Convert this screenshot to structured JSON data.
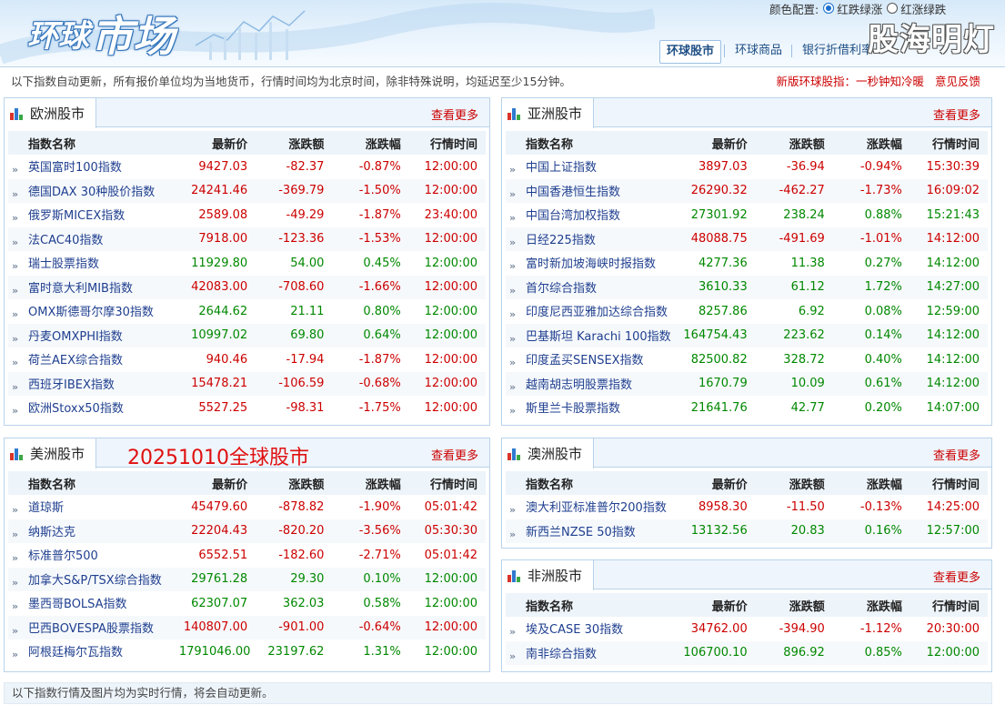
{
  "header": {
    "logo_part1": "环球",
    "logo_part2": "市场",
    "color_config_label": "颜色配置:",
    "color_options": [
      "红跌绿涨",
      "红涨绿跌"
    ],
    "watermark": "股海明灯",
    "nav": [
      "环球股市",
      "环球商品",
      "银行折借利率"
    ]
  },
  "notice": {
    "text": "以下指数自动更新，所有报价单位均为当地货币，行情时间均为北京时间，除非特殊说明，均延迟至少15分钟。",
    "links": [
      "新版环球股指：一秒钟知冷暖",
      "意见反馈"
    ]
  },
  "columns": [
    "指数名称",
    "最新价",
    "涨跌额",
    "涨跌幅",
    "行情时间"
  ],
  "more_label": "查看更多",
  "colors": {
    "up": "#cc0000",
    "down": "#008800",
    "link": "#1f3f8f",
    "accent": "#1a6fd0"
  },
  "panels": {
    "europe": {
      "title": "欧洲股市",
      "rows": [
        {
          "name": "英国富时100指数",
          "price": "9427.03",
          "chg": "-82.37",
          "pct": "-0.87%",
          "time": "12:00:00",
          "dir": "up"
        },
        {
          "name": "德国DAX 30种股价指数",
          "price": "24241.46",
          "chg": "-369.79",
          "pct": "-1.50%",
          "time": "12:00:00",
          "dir": "up"
        },
        {
          "name": "俄罗斯MICEX指数",
          "price": "2589.08",
          "chg": "-49.29",
          "pct": "-1.87%",
          "time": "23:40:00",
          "dir": "up"
        },
        {
          "name": "法CAC40指数",
          "price": "7918.00",
          "chg": "-123.36",
          "pct": "-1.53%",
          "time": "12:00:00",
          "dir": "up"
        },
        {
          "name": "瑞士股票指数",
          "price": "11929.80",
          "chg": "54.00",
          "pct": "0.45%",
          "time": "12:00:00",
          "dir": "dn"
        },
        {
          "name": "富时意大利MIB指数",
          "price": "42083.00",
          "chg": "-708.60",
          "pct": "-1.66%",
          "time": "12:00:00",
          "dir": "up"
        },
        {
          "name": "OMX斯德哥尔摩30指数",
          "price": "2644.62",
          "chg": "21.11",
          "pct": "0.80%",
          "time": "12:00:00",
          "dir": "dn"
        },
        {
          "name": "丹麦OMXPHI指数",
          "price": "10997.02",
          "chg": "69.80",
          "pct": "0.64%",
          "time": "12:00:00",
          "dir": "dn"
        },
        {
          "name": "荷兰AEX综合指数",
          "price": "940.46",
          "chg": "-17.94",
          "pct": "-1.87%",
          "time": "12:00:00",
          "dir": "up"
        },
        {
          "name": "西班牙IBEX指数",
          "price": "15478.21",
          "chg": "-106.59",
          "pct": "-0.68%",
          "time": "12:00:00",
          "dir": "up"
        },
        {
          "name": "欧洲Stoxx50指数",
          "price": "5527.25",
          "chg": "-98.31",
          "pct": "-1.75%",
          "time": "12:00:00",
          "dir": "up"
        }
      ]
    },
    "asia": {
      "title": "亚洲股市",
      "rows": [
        {
          "name": "中国上证指数",
          "price": "3897.03",
          "chg": "-36.94",
          "pct": "-0.94%",
          "time": "15:30:39",
          "dir": "up"
        },
        {
          "name": "中国香港恒生指数",
          "price": "26290.32",
          "chg": "-462.27",
          "pct": "-1.73%",
          "time": "16:09:02",
          "dir": "up"
        },
        {
          "name": "中国台湾加权指数",
          "price": "27301.92",
          "chg": "238.24",
          "pct": "0.88%",
          "time": "15:21:43",
          "dir": "dn"
        },
        {
          "name": "日经225指数",
          "price": "48088.75",
          "chg": "-491.69",
          "pct": "-1.01%",
          "time": "14:12:00",
          "dir": "up"
        },
        {
          "name": "富时新加坡海峡时报指数",
          "price": "4277.36",
          "chg": "11.38",
          "pct": "0.27%",
          "time": "14:12:00",
          "dir": "dn"
        },
        {
          "name": "首尔综合指数",
          "price": "3610.33",
          "chg": "61.12",
          "pct": "1.72%",
          "time": "14:27:00",
          "dir": "dn"
        },
        {
          "name": "印度尼西亚雅加达综合指数",
          "price": "8257.86",
          "chg": "6.92",
          "pct": "0.08%",
          "time": "12:59:00",
          "dir": "dn"
        },
        {
          "name": "巴基斯坦 Karachi 100指数",
          "price": "164754.43",
          "chg": "223.62",
          "pct": "0.14%",
          "time": "14:12:00",
          "dir": "dn"
        },
        {
          "name": "印度孟买SENSEX指数",
          "price": "82500.82",
          "chg": "328.72",
          "pct": "0.40%",
          "time": "14:12:00",
          "dir": "dn"
        },
        {
          "name": "越南胡志明股票指数",
          "price": "1670.79",
          "chg": "10.09",
          "pct": "0.61%",
          "time": "14:12:00",
          "dir": "dn"
        },
        {
          "name": "斯里兰卡股票指数",
          "price": "21641.76",
          "chg": "42.77",
          "pct": "0.20%",
          "time": "14:07:00",
          "dir": "dn"
        }
      ]
    },
    "america": {
      "title": "美洲股市",
      "extra": "20251010全球股市",
      "rows": [
        {
          "name": "道琼斯",
          "price": "45479.60",
          "chg": "-878.82",
          "pct": "-1.90%",
          "time": "05:01:42",
          "dir": "up"
        },
        {
          "name": "纳斯达克",
          "price": "22204.43",
          "chg": "-820.20",
          "pct": "-3.56%",
          "time": "05:30:30",
          "dir": "up"
        },
        {
          "name": "标准普尔500",
          "price": "6552.51",
          "chg": "-182.60",
          "pct": "-2.71%",
          "time": "05:01:42",
          "dir": "up"
        },
        {
          "name": "加拿大S&P/TSX综合指数",
          "price": "29761.28",
          "chg": "29.30",
          "pct": "0.10%",
          "time": "12:00:00",
          "dir": "dn"
        },
        {
          "name": "墨西哥BOLSA指数",
          "price": "62307.07",
          "chg": "362.03",
          "pct": "0.58%",
          "time": "12:00:00",
          "dir": "dn"
        },
        {
          "name": "巴西BOVESPA股票指数",
          "price": "140807.00",
          "chg": "-901.00",
          "pct": "-0.64%",
          "time": "12:00:00",
          "dir": "up"
        },
        {
          "name": "阿根廷梅尔瓦指数",
          "price": "1791046.00",
          "chg": "23197.62",
          "pct": "1.31%",
          "time": "12:00:00",
          "dir": "dn"
        }
      ]
    },
    "oceania": {
      "title": "澳洲股市",
      "rows": [
        {
          "name": "澳大利亚标准普尔200指数",
          "price": "8958.30",
          "chg": "-11.50",
          "pct": "-0.13%",
          "time": "14:25:00",
          "dir": "up"
        },
        {
          "name": "新西兰NZSE 50指数",
          "price": "13132.56",
          "chg": "20.83",
          "pct": "0.16%",
          "time": "12:57:00",
          "dir": "dn"
        }
      ]
    },
    "africa": {
      "title": "非洲股市",
      "rows": [
        {
          "name": "埃及CASE 30指数",
          "price": "34762.00",
          "chg": "-394.90",
          "pct": "-1.12%",
          "time": "20:30:00",
          "dir": "up"
        },
        {
          "name": "南非综合指数",
          "price": "106700.10",
          "chg": "896.92",
          "pct": "0.85%",
          "time": "12:00:00",
          "dir": "dn"
        }
      ]
    }
  },
  "footer": "以下指数行情及图片均为实时行情，将会自动更新。"
}
